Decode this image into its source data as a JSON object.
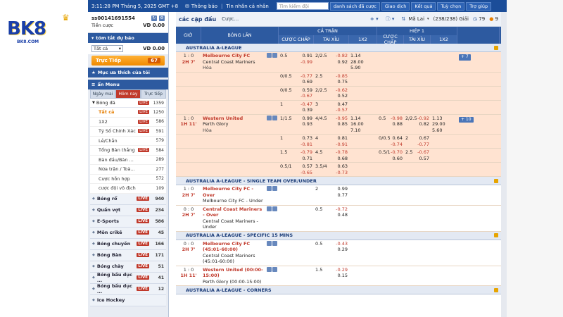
{
  "logo": {
    "text": "BK8",
    "sub": "BK8.COM"
  },
  "topbar": {
    "datetime": "3:11:28 PM Tháng 5, 2025 GMT +8",
    "notice": "Thông báo",
    "inbox": "Tin nhắn cá nhân",
    "search_placeholder": "Tìm kiếm đội",
    "nav": [
      "danh sách đã cược",
      "Giao dịch",
      "Kết quả",
      "Tuỳ chọn",
      "Trợ giúp"
    ]
  },
  "sidebar": {
    "account_id": "ss00141691554",
    "balance_label": "Tiền cược",
    "balance_value": "VD  0.00",
    "summary_title": "tóm tắt dự báo",
    "filter_select": "Tất cả",
    "filter_value": "VD  0.00",
    "live_button": "Trực Tiếp",
    "live_count": "67",
    "favorites_title": "Mục ưa thích của tôi",
    "menu_title": "ẩn Menu",
    "menu_tabs": [
      "Ngày mai",
      "Hôm nay",
      "Trực tiếp"
    ],
    "sports": [
      {
        "name": "Bóng đá",
        "live": "LIVE",
        "count": "1359"
      }
    ],
    "sub_items": [
      {
        "name": "Tất cả",
        "live": "LIVE",
        "count": "1250",
        "active": true
      },
      {
        "name": "1X2",
        "live": "LIVE",
        "count": "586"
      },
      {
        "name": "Tỷ Số Chính Xác",
        "live": "LIVE",
        "count": "591"
      },
      {
        "name": "Lẻ/Chẵn",
        "live": "",
        "count": "579"
      },
      {
        "name": "Tổng Bàn thắng",
        "live": "LIVE",
        "count": "584"
      },
      {
        "name": "Bàn đầu/Bàn ...",
        "live": "",
        "count": "289"
      },
      {
        "name": "Nửa trận / Toà...",
        "live": "",
        "count": "277"
      },
      {
        "name": "Cược hỗn hợp",
        "live": "",
        "count": "572"
      },
      {
        "name": "cược đội vô địch",
        "live": "",
        "count": "109"
      }
    ],
    "categories": [
      {
        "name": "Bóng rổ",
        "live": "LIVE",
        "count": "940"
      },
      {
        "name": "Quần vợt",
        "live": "LIVE",
        "count": "234"
      },
      {
        "name": "E-Sports",
        "live": "LIVE",
        "count": "586"
      },
      {
        "name": "Môn crikê",
        "live": "LIVE",
        "count": "45"
      },
      {
        "name": "Bóng chuyền",
        "live": "LIVE",
        "count": "166"
      },
      {
        "name": "Bóng Bàn",
        "live": "LIVE",
        "count": "171"
      },
      {
        "name": "Bóng chày",
        "live": "LIVE",
        "count": "51"
      },
      {
        "name": "Bóng bầu dục ...",
        "live": "LIVE",
        "count": "41"
      },
      {
        "name": "Bóng bầu dục ...",
        "live": "LIVE",
        "count": "12"
      },
      {
        "name": "Ice Hockey",
        "live": "",
        "count": ""
      }
    ]
  },
  "main": {
    "title": "các cặp đấu",
    "subtitle": "Cược...",
    "toolbar": {
      "sort": "Mã Lai",
      "count": "(238/238) Giải",
      "fav_count": "79",
      "alt_count": "9"
    },
    "headers": {
      "time": "GIỜ",
      "teams": "BÓNG LĂN",
      "fulltime": "CẢ TRẬN",
      "half": "HIỆP 1",
      "hdp": "CƯỢC CHẤP",
      "ou": "TÀI XỈU",
      "x12": "1X2"
    },
    "leagues": [
      {
        "name": "AUSTRALIA A-LEAGUE",
        "matches": [
          {
            "score": "1 : 0",
            "live": "2H 7'",
            "home": "Melbourne City FC",
            "away": "Central Coast Mariners",
            "draw": "Hòa",
            "lines": [
              {
                "h": "0.5",
                "o1": "0.91",
                "ou": "2/2.5",
                "o2": "-0.82",
                "x": "1.14",
                "o1b": "-0.99",
                "o2b": "0.92",
                "xb": "28.00",
                "xc": "5.90"
              },
              {
                "h": "0/0.5",
                "o1": "-0.77",
                "ou": "2.5",
                "o2": "-0.85",
                "o1b": "0.69",
                "o2b": "0.75"
              },
              {
                "h": "0/0.5",
                "o1": "0.59",
                "ou": "2/2.5",
                "o2": "-0.62",
                "o1b": "-0.67",
                "o2b": "0.52"
              },
              {
                "h": "1",
                "o1": "-0.47",
                "ou": "3",
                "o2": "0.47",
                "o1b": "0.39",
                "o2b": "-0.57"
              }
            ],
            "more": "+ 7"
          },
          {
            "score": "1 : 0",
            "live": "1H 11'",
            "home": "Western United",
            "away": "Perth Glory",
            "draw": "Hòa",
            "lines": [
              {
                "h": "1/1.5",
                "o1": "0.99",
                "ou": "4/4.5",
                "o2": "-0.95",
                "x": "1.14",
                "o1b": "0.93",
                "o2b": "0.85",
                "xb": "16.00",
                "xc": "7.10",
                "hh": "0.5",
                "ho1": "-0.98",
                "hou": "2/2.5",
                "ho2": "-0.92",
                "hx": "1.13",
                "ho1b": "0.88",
                "ho2b": "0.82",
                "hxb": "29.00",
                "hxc": "5.60"
              },
              {
                "h": "1",
                "o1": "0.73",
                "ou": "4",
                "o2": "0.81",
                "o1b": "-0.81",
                "o2b": "-0.91",
                "hh": "0/0.5",
                "ho1": "0.64",
                "hou": "2",
                "ho2": "0.67",
                "ho1b": "-0.74",
                "ho2b": "-0.77"
              },
              {
                "h": "1.5",
                "o1": "-0.79",
                "ou": "4.5",
                "o2": "-0.78",
                "o1b": "0.71",
                "o2b": "0.68",
                "hh": "0.5/1",
                "ho1": "-0.70",
                "hou": "2.5",
                "ho2": "-0.67",
                "ho1b": "0.60",
                "ho2b": "0.57"
              },
              {
                "h": "0.5/1",
                "o1": "0.57",
                "ou": "3.5/4",
                "o2": "0.63",
                "o1b": "-0.65",
                "o2b": "-0.73"
              }
            ],
            "more": "+ 10"
          }
        ]
      },
      {
        "name": "AUSTRALIA A-LEAGUE - SINGLE TEAM OVER/UNDER",
        "matches": [
          {
            "score": "1 : 0",
            "live": "2H 7'",
            "home": "Melbourne City FC - Over",
            "away": "Melbourne City FC - Under",
            "lines": [
              {
                "ou": "2",
                "o2": "0.99",
                "o2b": "0.77"
              }
            ]
          },
          {
            "score": "0 : 0",
            "live": "2H 7'",
            "home": "Central Coast Mariners - Over",
            "away": "Central Coast Mariners - Under",
            "lines": [
              {
                "ou": "0.5",
                "o2": "-0.72",
                "o2b": "0.48"
              }
            ]
          }
        ]
      },
      {
        "name": "AUSTRALIA A-LEAGUE - SPECIFIC 15 MINS",
        "matches": [
          {
            "score": "0 : 0",
            "live": "2H 7'",
            "home": "Melbourne City FC (45:01-60:00)",
            "away": "Central Coast Mariners (45:01-60:00)",
            "lines": [
              {
                "ou": "0.5",
                "o2": "-0.43",
                "o2b": "0.29"
              }
            ]
          },
          {
            "score": "1 : 0",
            "live": "1H 11'",
            "home": "Western United (00:00-15:00)",
            "away": "Perth Glory (00:00-15:00)",
            "lines": [
              {
                "ou": "1.5",
                "o2": "-0.29",
                "o2b": "0.15"
              }
            ]
          }
        ]
      },
      {
        "name": "AUSTRALIA A-LEAGUE - CORNERS",
        "matches": []
      }
    ]
  }
}
